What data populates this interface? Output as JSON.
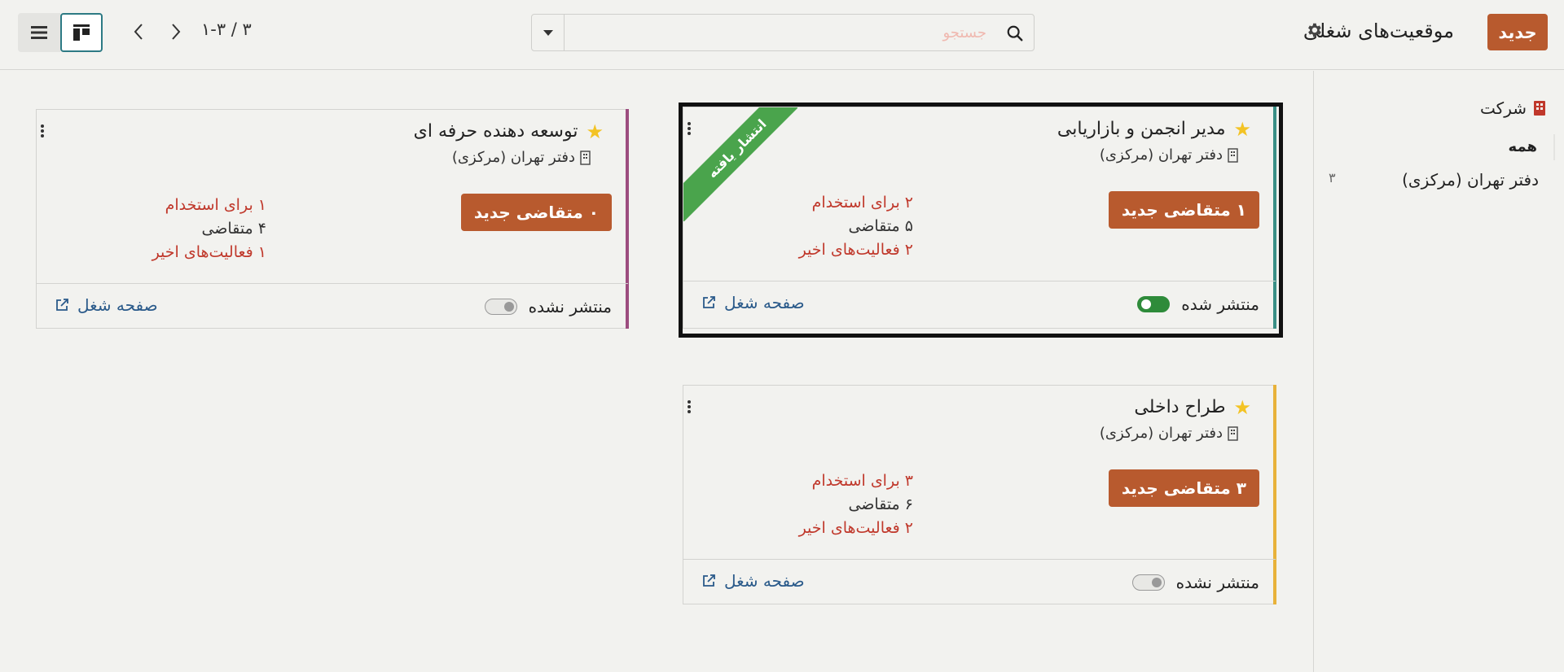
{
  "header": {
    "new_label": "جدید",
    "title": "موقعیت‌های شغلی",
    "search_placeholder": "جستجو",
    "pager": "۱-۳ / ۳"
  },
  "side_panel": {
    "header": "شرکت",
    "items": [
      {
        "label": "همه"
      },
      {
        "label": "دفتر تهران (مرکزی)",
        "count": "۳"
      }
    ]
  },
  "cards": [
    {
      "title": "مدیر انجمن و بازاریابی",
      "office": "دفتر تهران (مرکزی)",
      "apply_label": "۱ متقاضی جدید",
      "to_recruit": "۲ برای استخدام",
      "applicants": "۵ متقاضی",
      "activities": "۲ فعالیت‌های اخیر",
      "publish_status": "منتشر شده",
      "published": true,
      "ribbon": "انتشار یافته",
      "job_page": "صفحه شغل",
      "accent": "#3a8f86"
    },
    {
      "title": "توسعه دهنده حرفه ای",
      "office": "دفتر تهران (مرکزی)",
      "apply_label": "۰ متقاضی جدید",
      "to_recruit": "۱ برای استخدام",
      "applicants": "۴ متقاضی",
      "activities": "۱ فعالیت‌های اخیر",
      "publish_status": "منتشر نشده",
      "published": false,
      "job_page": "صفحه شغل",
      "accent": "#9c4d7f"
    },
    {
      "title": "طراح داخلی",
      "office": "دفتر تهران (مرکزی)",
      "apply_label": "۳ متقاضی جدید",
      "to_recruit": "۳ برای استخدام",
      "applicants": "۶ متقاضی",
      "activities": "۲ فعالیت‌های اخیر",
      "publish_status": "منتشر نشده",
      "published": false,
      "job_page": "صفحه شغل",
      "accent": "#e8b23a"
    }
  ]
}
